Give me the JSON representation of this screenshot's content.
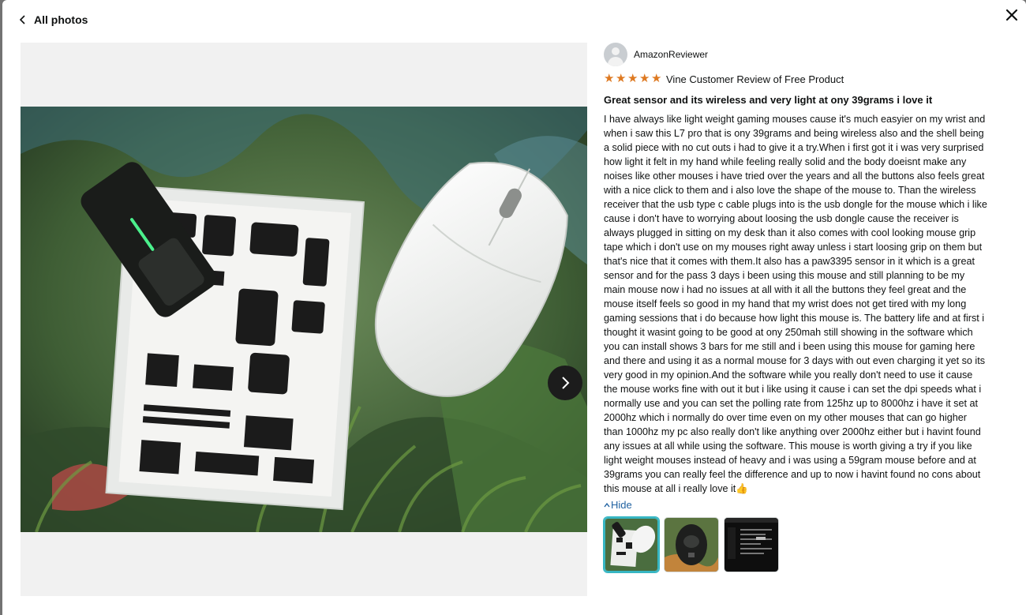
{
  "header": {
    "back_label": "All photos",
    "close_icon": "close-icon",
    "back_icon": "chevron-left-icon"
  },
  "viewer": {
    "next_icon": "chevron-right-icon"
  },
  "review": {
    "reviewer_name": "AmazonReviewer",
    "rating": 5,
    "rating_max": 5,
    "vine_label": "Vine Customer Review of Free Product",
    "title": "Great sensor and its wireless and very light at ony 39grams i love it",
    "body": "I have always like light weight gaming mouses cause it's much easyier on my wrist and when i saw this L7 pro that is ony 39grams and being wireless also and the shell being a solid piece with no cut outs i had to give it a try.When i first got it i was very surprised how light it felt in my hand while feeling really solid and the body doeisnt make any noises like other mouses i have tried over the years and all the buttons also feels great with a nice click to them and i also love the shape of the mouse to. Than the wireless receiver that the usb type c cable plugs into is the usb dongle for the mouse which i like cause i don't have to worrying about loosing the usb dongle cause the receiver is always plugged in sitting on my desk than it also comes with cool looking mouse grip tape which i don't use on my mouses right away unless i start loosing grip on them but that's nice that it comes with them.It also has a paw3395 sensor in it which is a great sensor and for the pass 3 days i been using this mouse and still planning to be my main mouse now i had no issues at all with it all the buttons they feel great and the mouse itself feels so good in my hand that my wrist does not get tired with my long gaming sessions that i do because how light this mouse is. The battery life and at first i thought it wasint going to be good at ony 250mah still showing in the software which you can install shows 3 bars for me still and i been using this mouse for gaming here and there and using it as a normal mouse for 3 days with out even charging it yet so its very good in my opinion.And the software while you really don't need to use it cause the mouse works fine with out it but i like using it cause i can set the dpi speeds what i normally use and you can set the polling rate from 125hz up to 8000hz i have it set at 2000hz which i normally do over time even on my other mouses that can go higher than 1000hz my pc also really don't like anything over 2000hz either but i havint found any issues at all while using the software. This mouse is worth giving a try if you like light weight mouses instead of heavy and i was using a 59gram mouse before and at 39grams you can really feel the difference and up to now i havint found no cons about this mouse at all i really love it👍",
    "hide_label": "Hide"
  },
  "thumbnails": [
    {
      "name": "thumbnail-stickers",
      "active": true
    },
    {
      "name": "thumbnail-mouse-bottom",
      "active": false
    },
    {
      "name": "thumbnail-software",
      "active": false
    }
  ],
  "colors": {
    "star": "#de7921",
    "link": "#2162a1",
    "active_thumb": "#37b6c3"
  }
}
